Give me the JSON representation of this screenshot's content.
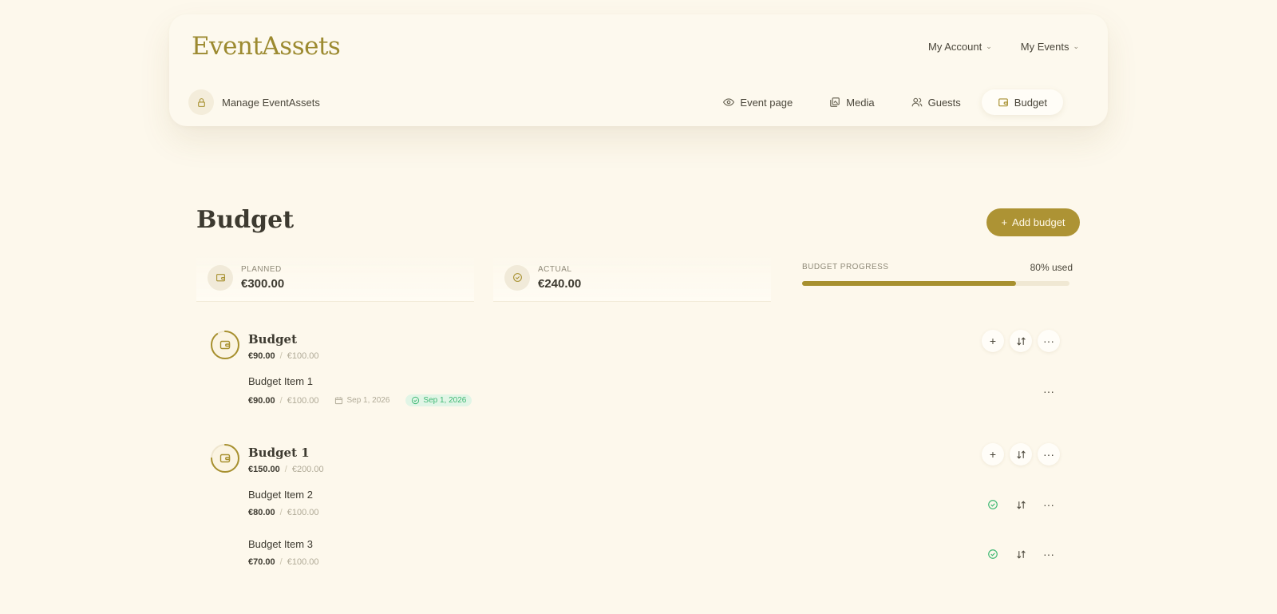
{
  "app": {
    "logo": "EventAssets"
  },
  "top_nav": [
    {
      "label": "My Account"
    },
    {
      "label": "My Events"
    }
  ],
  "manage": {
    "label": "Manage EventAssets"
  },
  "tabs": [
    {
      "label": "Event page",
      "icon": "eye-icon"
    },
    {
      "label": "Media",
      "icon": "media-icon"
    },
    {
      "label": "Guests",
      "icon": "guests-icon"
    },
    {
      "label": "Budget",
      "icon": "wallet-icon",
      "active": true
    }
  ],
  "page": {
    "title": "Budget",
    "add_button": "Add budget"
  },
  "summary": {
    "planned_label": "PLANNED",
    "planned_value": "€300.00",
    "actual_label": "ACTUAL",
    "actual_value": "€240.00",
    "progress_label": "BUDGET PROGRESS",
    "progress_text": "80% used",
    "progress_fraction": 0.8
  },
  "groups": [
    {
      "name": "Budget",
      "actual": "€90.00",
      "planned": "€100.00",
      "progress_fraction": 0.9,
      "items": [
        {
          "name": "Budget Item 1",
          "actual": "€90.00",
          "planned": "€100.00",
          "due_date": "Sep 1, 2026",
          "paid_date": "Sep 1, 2026"
        }
      ]
    },
    {
      "name": "Budget 1",
      "actual": "€150.00",
      "planned": "€200.00",
      "progress_fraction": 0.75,
      "items": [
        {
          "name": "Budget Item 2",
          "actual": "€80.00",
          "planned": "€100.00"
        },
        {
          "name": "Budget Item 3",
          "actual": "€70.00",
          "planned": "€100.00"
        }
      ]
    }
  ],
  "colors": {
    "accent": "#ad9334",
    "background": "#fdf8ec",
    "success": "#3eb873"
  }
}
